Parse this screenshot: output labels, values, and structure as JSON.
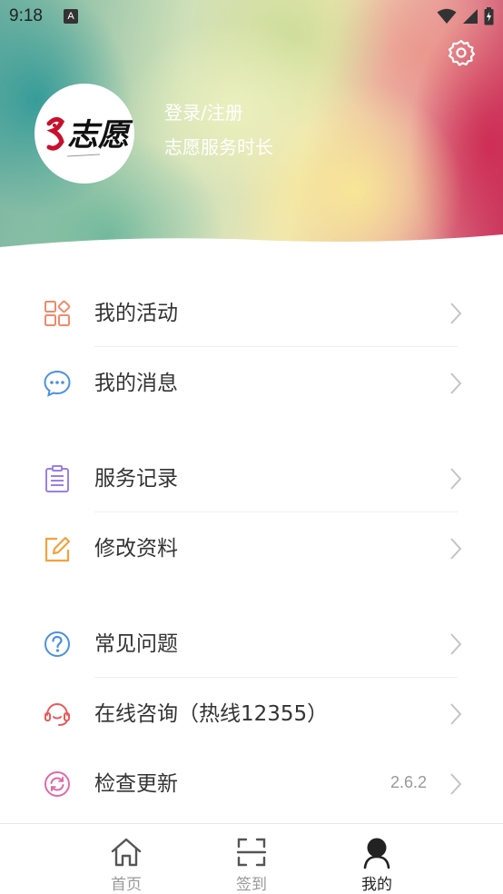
{
  "status_bar": {
    "time": "9:18",
    "notification_letter": "A"
  },
  "header": {
    "avatar_logo_text": "志愿",
    "login_label": "登录/注册",
    "service_hours_label": "志愿服务时长"
  },
  "menu": {
    "groups": [
      [
        {
          "label": "我的活动",
          "icon": "grid-apps-icon",
          "color": "#f08a6b"
        },
        {
          "label": "我的消息",
          "icon": "chat-bubble-icon",
          "color": "#4a90e2"
        }
      ],
      [
        {
          "label": "服务记录",
          "icon": "clipboard-list-icon",
          "color": "#9b7fe6"
        },
        {
          "label": "修改资料",
          "icon": "edit-icon",
          "color": "#f5a13b"
        }
      ],
      [
        {
          "label": "常见问题",
          "icon": "question-circle-icon",
          "color": "#4a90e2"
        },
        {
          "label": "在线咨询（热线12355）",
          "icon": "headset-icon",
          "color": "#e85a5a"
        },
        {
          "label": "检查更新",
          "icon": "refresh-icon",
          "color": "#e06aa8",
          "version": "2.6.2"
        }
      ]
    ]
  },
  "bottom_nav": {
    "tabs": [
      {
        "label": "首页",
        "icon": "home-icon",
        "active": false
      },
      {
        "label": "签到",
        "icon": "scan-icon",
        "active": false
      },
      {
        "label": "我的",
        "icon": "user-icon",
        "active": true
      }
    ]
  },
  "colors": {
    "text_primary": "#333333",
    "text_muted": "#999999",
    "active_tab": "#222222"
  }
}
